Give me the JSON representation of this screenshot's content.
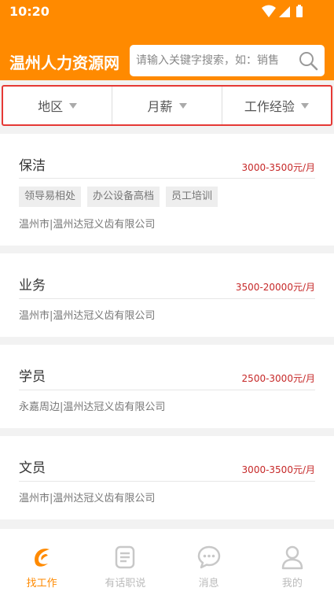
{
  "status_bar": {
    "time": "10:20"
  },
  "header": {
    "title": "温州人力资源网",
    "search_placeholder": "请输入关键字搜索，如：销售"
  },
  "filters": [
    {
      "label": "地区"
    },
    {
      "label": "月薪"
    },
    {
      "label": "工作经验"
    }
  ],
  "jobs": [
    {
      "title": "保洁",
      "salary": "3000-3500元/月",
      "tags": [
        "领导易相处",
        "办公设备高档",
        "员工培训"
      ],
      "company": "温州市|温州达冠义齿有限公司"
    },
    {
      "title": "业务",
      "salary": "3500-20000元/月",
      "tags": [],
      "company": "温州市|温州达冠义齿有限公司"
    },
    {
      "title": "学员",
      "salary": "2500-3000元/月",
      "tags": [],
      "company": "永嘉周边|温州达冠义齿有限公司"
    },
    {
      "title": "文员",
      "salary": "3000-3500元/月",
      "tags": [],
      "company": "温州市|温州达冠义齿有限公司"
    }
  ],
  "tabs": [
    {
      "label": "找工作",
      "icon": "find-job-icon",
      "active": true
    },
    {
      "label": "有话职说",
      "icon": "document-icon",
      "active": false
    },
    {
      "label": "消息",
      "icon": "message-icon",
      "active": false
    },
    {
      "label": "我的",
      "icon": "profile-icon",
      "active": false
    }
  ],
  "colors": {
    "brand": "#ff8a00",
    "salary": "#c62828",
    "filter_highlight": "#e53935"
  }
}
